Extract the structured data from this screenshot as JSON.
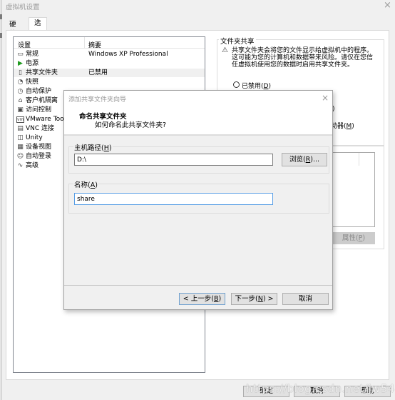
{
  "window": {
    "title": "虚拟机设置",
    "close_glyph": "×"
  },
  "tabs": [
    {
      "label": "硬件",
      "active": false
    },
    {
      "label": "选项",
      "active": true
    }
  ],
  "settings_list": {
    "columns": [
      "设置",
      "摘要"
    ],
    "rows": [
      {
        "icon": "general-icon",
        "glyph": "▭",
        "label": "常规",
        "summary": "Windows XP Professional",
        "selected": false
      },
      {
        "icon": "power-icon",
        "glyph": "▶",
        "label": "电源",
        "summary": "",
        "selected": false
      },
      {
        "icon": "shared-folder-icon",
        "glyph": "▯",
        "label": "共享文件夹",
        "summary": "已禁用",
        "selected": true
      },
      {
        "icon": "snapshot-icon",
        "glyph": "◔",
        "label": "快照",
        "summary": "",
        "selected": false
      },
      {
        "icon": "autoprotect-icon",
        "glyph": "◷",
        "label": "自动保护",
        "summary": "",
        "selected": false
      },
      {
        "icon": "guest-isolation-icon",
        "glyph": "⌂",
        "label": "客户机隔离",
        "summary": "",
        "selected": false
      },
      {
        "icon": "access-control-icon",
        "glyph": "▣",
        "label": "访问控制",
        "summary": "",
        "selected": false
      },
      {
        "icon": "vmware-tools-icon",
        "glyph": "vm",
        "label": "VMware Tools",
        "summary": "",
        "selected": false
      },
      {
        "icon": "vnc-icon",
        "glyph": "▤",
        "label": "VNC 连接",
        "summary": "",
        "selected": false
      },
      {
        "icon": "unity-icon",
        "glyph": "◫",
        "label": "Unity",
        "summary": "",
        "selected": false
      },
      {
        "icon": "device-view-icon",
        "glyph": "▦",
        "label": "设备视图",
        "summary": "",
        "selected": false
      },
      {
        "icon": "autologin-icon",
        "glyph": "☺",
        "label": "自动登录",
        "summary": "",
        "selected": false
      },
      {
        "icon": "advanced-icon",
        "glyph": "∿",
        "label": "高级",
        "summary": "",
        "selected": false
      }
    ]
  },
  "folder_sharing": {
    "legend": "文件夹共享",
    "warning": "共享文件夹会将您的文件显示给虚拟机中的程序。这可能为您的计算机和数据带来风险。请仅在您信任虚拟机使用您的数据时启用共享文件夹。",
    "option_disabled": "已禁用(D)",
    "option_disabled_key": "D",
    "partial_option_1": ")",
    "partial_option_2": "动器(M)",
    "properties_button": "属性(P)"
  },
  "buttons": {
    "ok": "确定",
    "cancel": "取消",
    "help": "帮助"
  },
  "watermark": "https://blog.csdn.net/jw5493",
  "wizard": {
    "title": "添加共享文件夹向导",
    "heading": "命名共享文件夹",
    "subheading": "如何命名此共享文件夹?",
    "host_path_label": "主机路径(H)",
    "host_path_value": "D:\\",
    "browse_button": "浏览(R)...",
    "name_label": "名称(A)",
    "name_value": "share",
    "back_button": "< 上一步(B)",
    "next_button": "下一步(N) >",
    "cancel_button": "取消",
    "close_glyph": "×"
  }
}
